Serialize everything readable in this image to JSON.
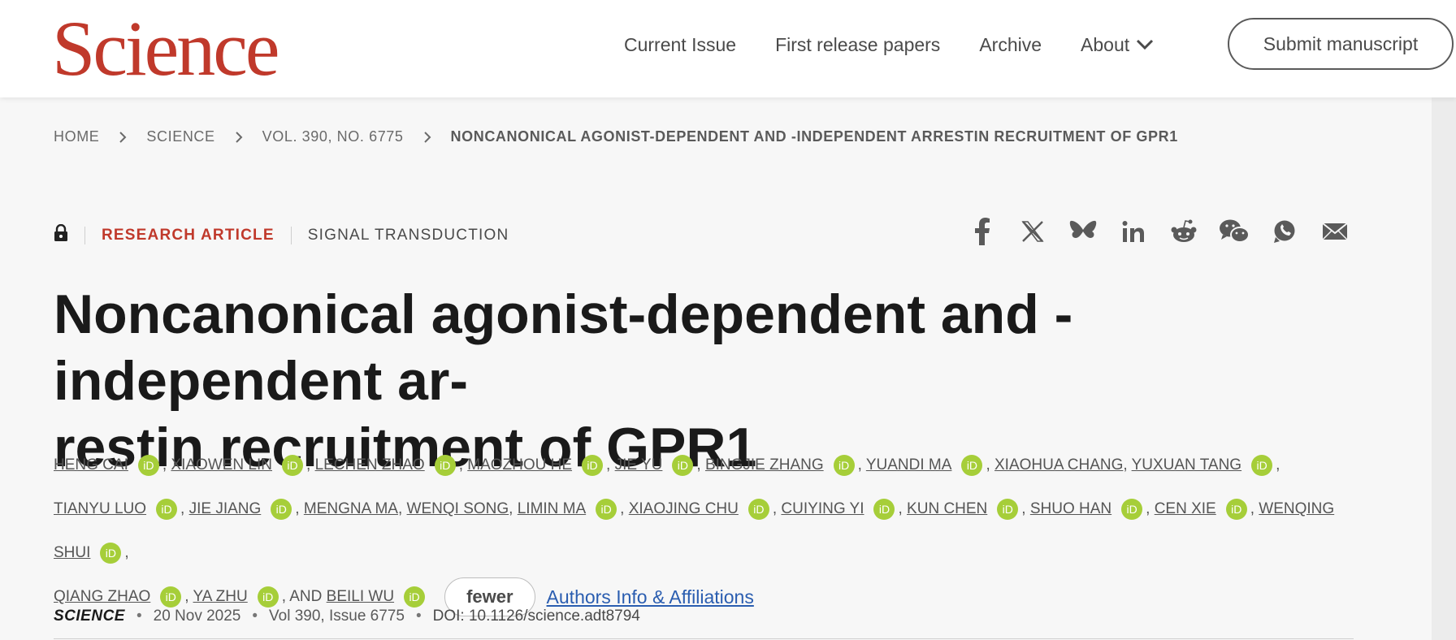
{
  "header": {
    "logo": "Science",
    "nav": [
      "Current Issue",
      "First release papers",
      "Archive",
      "About"
    ],
    "submit": "Submit manuscript"
  },
  "breadcrumb": [
    "HOME",
    "SCIENCE",
    "VOL. 390, NO. 6775",
    "NONCANONICAL AGONIST-DEPENDENT AND -INDEPENDENT ARRESTIN RECRUITMENT OF GPR1"
  ],
  "article": {
    "kicker": "RESEARCH ARTICLE",
    "subject": "SIGNAL TRANSDUCTION",
    "title_line1": "Noncanonical agonist-dependent and -independent ar-",
    "title_line2": "restin recruitment of GPR1",
    "authors": [
      {
        "name": "HENG CAI",
        "orcid": true
      },
      {
        "name": "XIAOWEN LIN",
        "orcid": true
      },
      {
        "name": "LECHEN ZHAO",
        "orcid": true
      },
      {
        "name": "MAOZHOU HE",
        "orcid": true
      },
      {
        "name": "JIE YU",
        "orcid": true
      },
      {
        "name": "BINGJIE ZHANG",
        "orcid": true
      },
      {
        "name": "YUANDI MA",
        "orcid": true
      },
      {
        "name": "XIAOHUA CHANG",
        "orcid": false
      },
      {
        "name": "YUXUAN TANG",
        "orcid": true
      },
      {
        "name": "TIANYU LUO",
        "orcid": true
      },
      {
        "name": "JIE JIANG",
        "orcid": true
      },
      {
        "name": "MENGNA MA",
        "orcid": false
      },
      {
        "name": "WENQI SONG",
        "orcid": false
      },
      {
        "name": "LIMIN MA",
        "orcid": true
      },
      {
        "name": "XIAOJING CHU",
        "orcid": true
      },
      {
        "name": "CUIYING YI",
        "orcid": true
      },
      {
        "name": "KUN CHEN",
        "orcid": true
      },
      {
        "name": "SHUO HAN",
        "orcid": true
      },
      {
        "name": "CEN XIE",
        "orcid": true
      },
      {
        "name": "WENQING SHUI",
        "orcid": true
      },
      {
        "name": "QIANG ZHAO",
        "orcid": true
      },
      {
        "name": "YA ZHU",
        "orcid": true
      },
      {
        "name": "BEILI WU",
        "orcid": true
      }
    ],
    "and_word": "AND",
    "fewer_label": "fewer",
    "affiliations_link": "Authors Info & Affiliations",
    "orcid_label": "iD",
    "journal": "SCIENCE",
    "date": "20 Nov 2025",
    "volume": "Vol 390, Issue 6775",
    "doi": "DOI: 10.1126/science.adt8794"
  },
  "colors": {
    "accent": "#c0392b",
    "link": "#2a5db0",
    "orcid": "#a6ce39"
  },
  "share_icons": [
    "facebook-icon",
    "x-icon",
    "bluesky-icon",
    "linkedin-icon",
    "reddit-icon",
    "wechat-icon",
    "whatsapp-icon",
    "email-icon"
  ]
}
